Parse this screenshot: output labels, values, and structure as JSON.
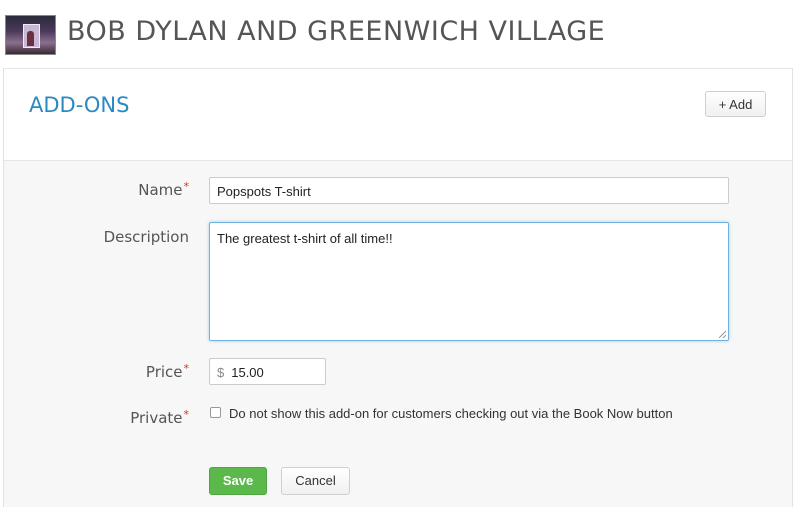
{
  "header": {
    "title": "BOB DYLAN AND GREENWICH VILLAGE",
    "thumbnail_icon": "tour-photo-thumbnail"
  },
  "section": {
    "title": "ADD-ONS",
    "add_button": "+ Add"
  },
  "form": {
    "name_label": "Name",
    "name_value": "Popspots T-shirt",
    "description_label": "Description",
    "description_value": "The greatest t-shirt of all time!!",
    "price_label": "Price",
    "price_currency": "$",
    "price_value": "15.00",
    "private_label": "Private",
    "private_checked": false,
    "private_checkbox_text": "Do not show this add-on for customers checking out via the Book Now button",
    "required_marker": "*"
  },
  "actions": {
    "save": "Save",
    "cancel": "Cancel"
  },
  "colors": {
    "accent": "#2a8ac2",
    "save_green": "#5bb84a",
    "required_red": "#c0392b"
  }
}
